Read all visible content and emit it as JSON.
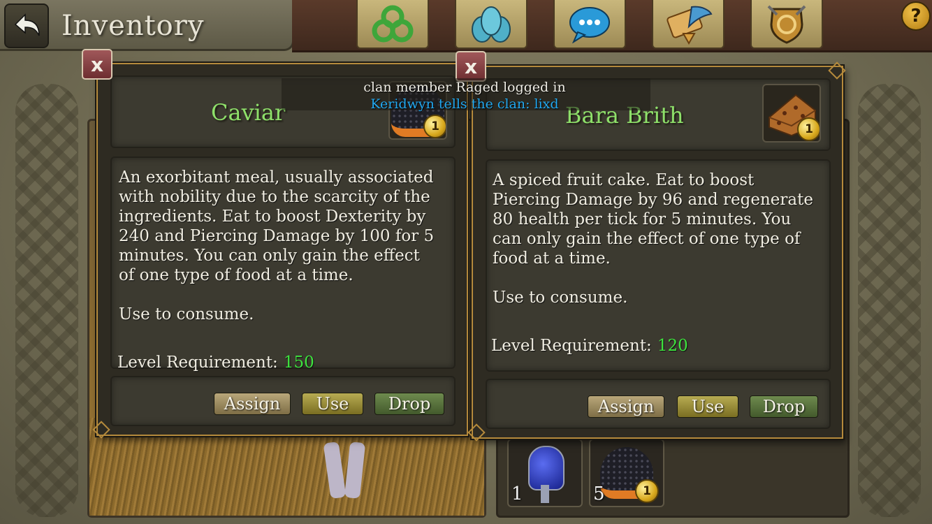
{
  "header": {
    "title": "Inventory",
    "back_icon": "back-arrow-icon",
    "nav": [
      {
        "name": "triskele-icon",
        "color": "#3ea63a"
      },
      {
        "name": "social-icon",
        "color": "#4fb0c8"
      },
      {
        "name": "chat-bubble-icon",
        "color": "#2a9ad8"
      },
      {
        "name": "scroll-quill-icon",
        "color": "#d8a040"
      },
      {
        "name": "guild-shield-icon",
        "color": "#c08a30"
      }
    ],
    "help_label": "?"
  },
  "chat": {
    "system_message": "clan member Raged logged in",
    "clan_message": "Keridwyn tells the clan: lixd"
  },
  "dialogs": [
    {
      "name": "Caviar",
      "icon": "caviar-icon",
      "icon_count": "1",
      "description": [
        "An exorbitant meal, usually associated",
        "with nobility due to the scarcity of the",
        "ingredients. Eat to boost Dexterity by",
        "240 and Piercing Damage by 100 for 5",
        "minutes. You can only gain the effect",
        "of one type of food at a time."
      ],
      "usage": "Use to consume.",
      "level_label": "Level Requirement:",
      "level_value": "150",
      "buttons": {
        "assign": "Assign",
        "use": "Use",
        "drop": "Drop"
      },
      "close_label": "x"
    },
    {
      "name": "Bara Brith",
      "icon": "fruit-cake-icon",
      "icon_count": "1",
      "description": [
        "A spiced fruit cake. Eat to boost",
        "Piercing Damage by 96 and regenerate",
        "80 health per tick for 5 minutes. You",
        "can only gain the effect of one type of",
        "food at a time."
      ],
      "usage": "Use to consume.",
      "level_label": "Level Requirement:",
      "level_value": "120",
      "buttons": {
        "assign": "Assign",
        "use": "Use",
        "drop": "Drop"
      },
      "close_label": "x"
    }
  ],
  "inventory_slots": [
    {
      "icon": "blue-potion-icon",
      "count": "1"
    },
    {
      "icon": "caviar-icon",
      "count": "5",
      "badge": "1"
    }
  ],
  "colors": {
    "item_name": "#8ee06a",
    "level_value": "#3ee33e",
    "clan_chat": "#22a8f0",
    "dialog_border": "#b58a3c"
  }
}
